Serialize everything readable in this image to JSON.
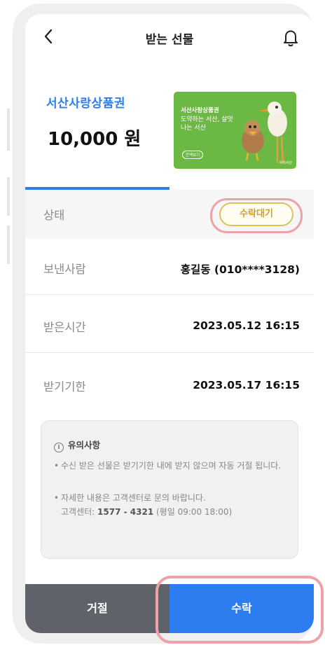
{
  "header": {
    "back_icon": "chevron-left-icon",
    "title": "받는 선물",
    "bell_icon": "bell-icon"
  },
  "gift": {
    "product_name": "서산사랑상품권",
    "amount": "10,000 원"
  },
  "card": {
    "title": "서산사랑상품권",
    "subtitle": "도약하는 서산, 살맛나는 서산",
    "button": "잔액보기",
    "brand": "우리서산",
    "color": "#6cb845"
  },
  "details": {
    "status_label": "상태",
    "status_value": "수락대기",
    "sender_label": "보낸사람",
    "sender_value": "홍길동 (010****3128)",
    "received_label": "받은시간",
    "received_value": "2023.05.12 16:15",
    "deadline_label": "받기기한",
    "deadline_value": "2023.05.17 16:15"
  },
  "notice": {
    "icon": "info-icon",
    "title": "유의사항",
    "item1": "수신 받은 선물은 받기기한 내에 받지 않으며 자동 거절 됩니다.",
    "item2_line1": "자세한 내용은 고객센터로 문의 바랍니다.",
    "item2_prefix": "고객센터: ",
    "item2_phone": "1577 - 4321",
    "item2_hours": " (평일 09:00 18:00)"
  },
  "actions": {
    "reject": "거절",
    "accept": "수락"
  },
  "colors": {
    "primary": "#2d7df0",
    "reject_bg": "#5f6369",
    "status_gold": "#d2a020",
    "highlight": "#eba3a7"
  }
}
